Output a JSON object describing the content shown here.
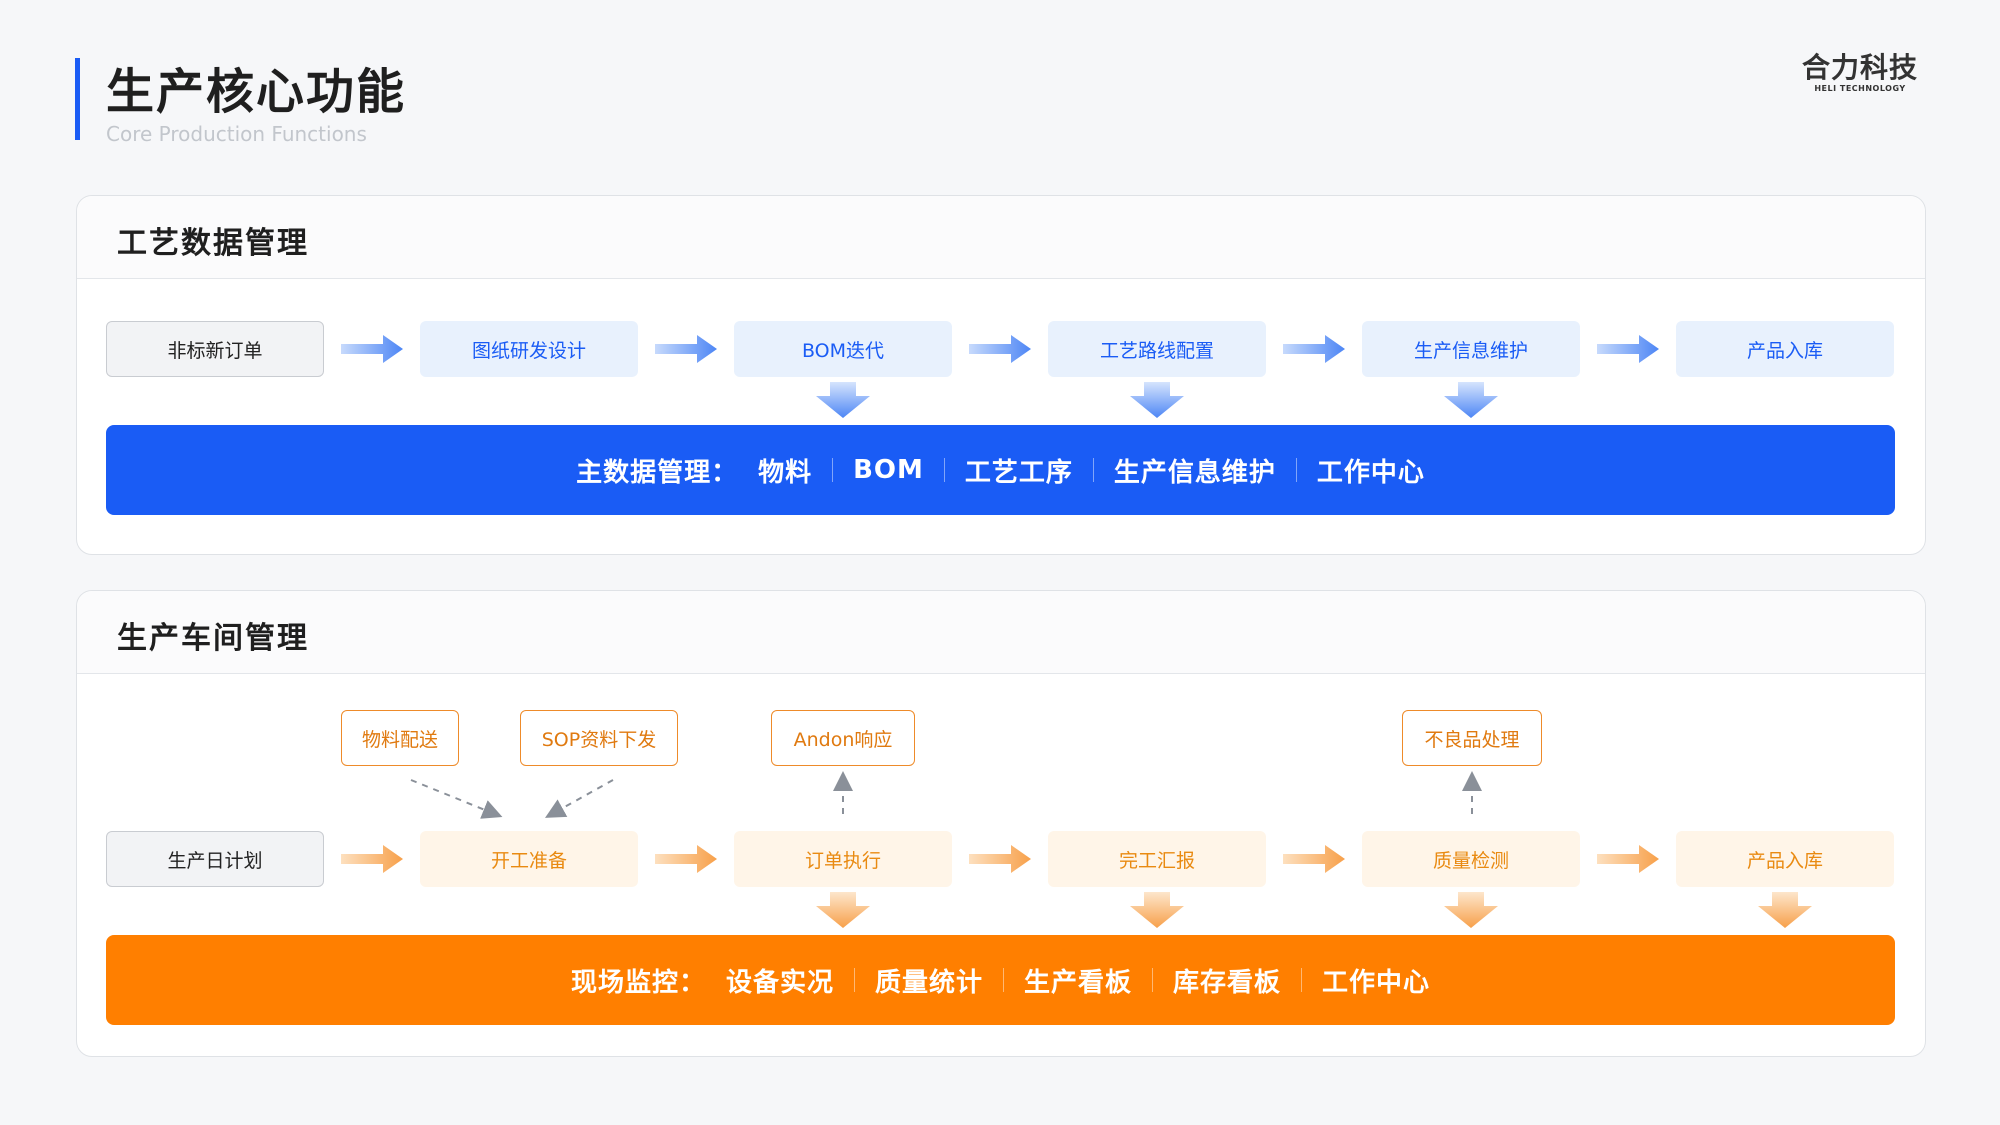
{
  "header": {
    "title": "生产核心功能",
    "subtitle": "Core Production Functions",
    "logo_main": "合力科技",
    "logo_sub": "HELI TECHNOLOGY"
  },
  "process_section": {
    "title": "工艺数据管理",
    "start": "非标新订单",
    "steps": [
      "图纸研发设计",
      "BOM迭代",
      "工艺路线配置",
      "生产信息维护",
      "产品入库"
    ],
    "band_label": "主数据管理：",
    "band_items": [
      "物料",
      "BOM",
      "工艺工序",
      "生产信息维护",
      "工作中心"
    ]
  },
  "workshop_section": {
    "title": "生产车间管理",
    "start": "生产日计划",
    "steps": [
      "开工准备",
      "订单执行",
      "完工汇报",
      "质量检测",
      "产品入库"
    ],
    "inputs": [
      "物料配送",
      "SOP资料下发",
      "Andon响应",
      "不良品处理"
    ],
    "band_label": "现场监控：",
    "band_items": [
      "设备实况",
      "质量统计",
      "生产看板",
      "库存看板",
      "工作中心"
    ]
  },
  "colors": {
    "accent_blue": "#1a5cf5",
    "accent_orange": "#ff7f00",
    "light_blue": "#e8f1fd",
    "light_orange": "#fff5e8"
  }
}
